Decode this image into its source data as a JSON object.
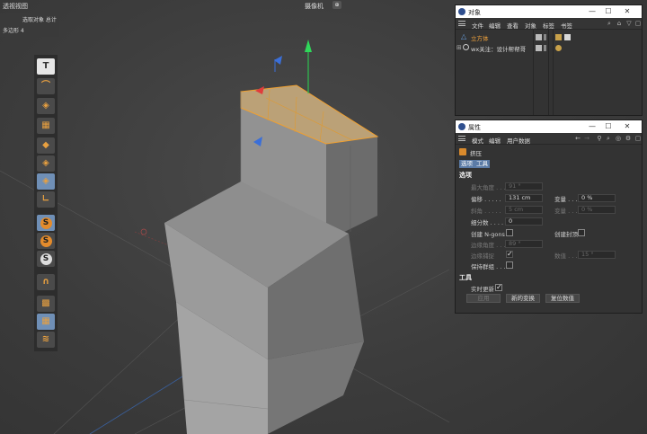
{
  "viewport": {
    "title": "透视视图",
    "camera_label": "摄像机",
    "camera_icon": "⊕",
    "hud_selected": "选取对象  总计",
    "hud_polygons": "多边形  4"
  },
  "toolbar": {
    "tools": [
      {
        "name": "text-tool-icon",
        "glyph": "T",
        "active": false,
        "light": true
      },
      {
        "name": "spline-tool-icon",
        "glyph": "⌒",
        "active": false
      },
      {
        "name": "cube-generator-icon",
        "glyph": "◈",
        "active": false
      },
      {
        "name": "checker-cube-icon",
        "glyph": "▦",
        "active": false
      },
      {
        "name": "cube-edit-icon",
        "glyph": "◆",
        "active": false
      },
      {
        "name": "cube-deform-icon",
        "glyph": "◈",
        "active": false
      },
      {
        "name": "cube-extrude-icon",
        "glyph": "◈",
        "active": true
      },
      {
        "name": "bend-tool-icon",
        "glyph": "∟",
        "active": false
      },
      {
        "name": "snap-tool-icon-1",
        "glyph": "S",
        "type": "s",
        "active": true
      },
      {
        "name": "snap-tool-icon-2",
        "glyph": "S",
        "type": "s",
        "active": false
      },
      {
        "name": "snap-tool-icon-3",
        "glyph": "S",
        "type": "s-light",
        "active": false
      },
      {
        "name": "magnet-tool-icon",
        "glyph": "∩",
        "active": false
      },
      {
        "name": "grid-tool-icon",
        "glyph": "▩",
        "active": false
      },
      {
        "name": "workplane-tool-icon",
        "glyph": "▦",
        "active": true
      },
      {
        "name": "layer-tool-icon",
        "glyph": "≋",
        "active": false
      }
    ]
  },
  "objects_window": {
    "title": "对象",
    "menu": [
      "文件",
      "编辑",
      "查看",
      "对象",
      "标签",
      "书签"
    ],
    "items": [
      {
        "name": "立方体",
        "color": "#f2a33c"
      },
      {
        "name": "wx关注：设计帮帮哥",
        "color": "#dddddd"
      }
    ]
  },
  "attributes_window": {
    "title": "属性",
    "menu": [
      "模式",
      "编辑",
      "用户数据"
    ],
    "object_name": "挤压",
    "tabs": [
      "选项",
      "工具"
    ],
    "section_options": "选项",
    "section_tool": "工具",
    "fields": {
      "max_angle_label": "最大角度 . . .",
      "max_angle_value": "91 °",
      "offset_label": "偏移 . . . . .",
      "offset_value": "131 cm",
      "variance_label": "变量 . . .",
      "variance_value": "0 %",
      "bevel_label": "斜角 . . . . .",
      "bevel_value": "5 cm",
      "variance2_label": "变量 . . .",
      "variance2_value": "0 %",
      "subdivision_label": "细分数 . . . .",
      "subdivision_value": "0",
      "create_ngons_label": "创建 N-gons",
      "create_caps_label": "创建封顶",
      "edge_angle_label": "边缘角度 . . .",
      "edge_angle_value": "89 °",
      "edge_snap_label": "边缘捕捉",
      "count_label": "数值 . . .",
      "count_value": "15 °",
      "keep_groups_label": "保持群组 . . .",
      "realtime_label": "实时更新",
      "apply_label": "应用",
      "new_transform_label": "新的变换",
      "reset_label": "复位数值"
    }
  }
}
